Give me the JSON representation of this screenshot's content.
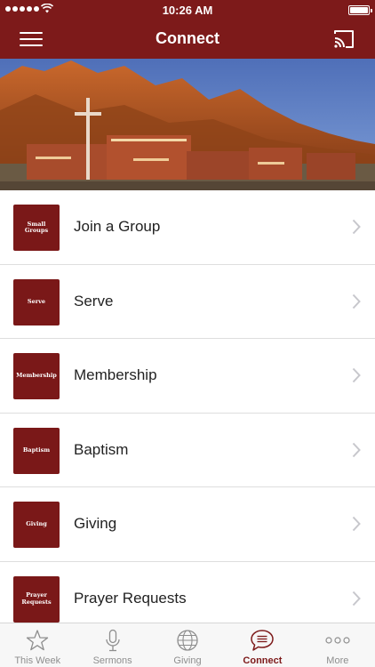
{
  "status_bar": {
    "time": "10:26 AM"
  },
  "nav": {
    "title": "Connect"
  },
  "colors": {
    "brand": "#7d1a1a",
    "tile": "#7a1818",
    "tab_inactive": "#8e8e8e"
  },
  "list": {
    "items": [
      {
        "thumb": "Small Groups",
        "label": "Join a Group"
      },
      {
        "thumb": "Serve",
        "label": "Serve"
      },
      {
        "thumb": "Membership",
        "label": "Membership"
      },
      {
        "thumb": "Baptism",
        "label": "Baptism"
      },
      {
        "thumb": "Giving",
        "label": "Giving"
      },
      {
        "thumb": "Prayer Requests",
        "label": "Prayer Requests"
      }
    ]
  },
  "tabs": [
    {
      "label": "This Week",
      "icon": "star-icon",
      "active": false
    },
    {
      "label": "Sermons",
      "icon": "microphone-icon",
      "active": false
    },
    {
      "label": "Giving",
      "icon": "globe-icon",
      "active": false
    },
    {
      "label": "Connect",
      "icon": "chat-bubble-icon",
      "active": true
    },
    {
      "label": "More",
      "icon": "more-dots-icon",
      "active": false
    }
  ]
}
